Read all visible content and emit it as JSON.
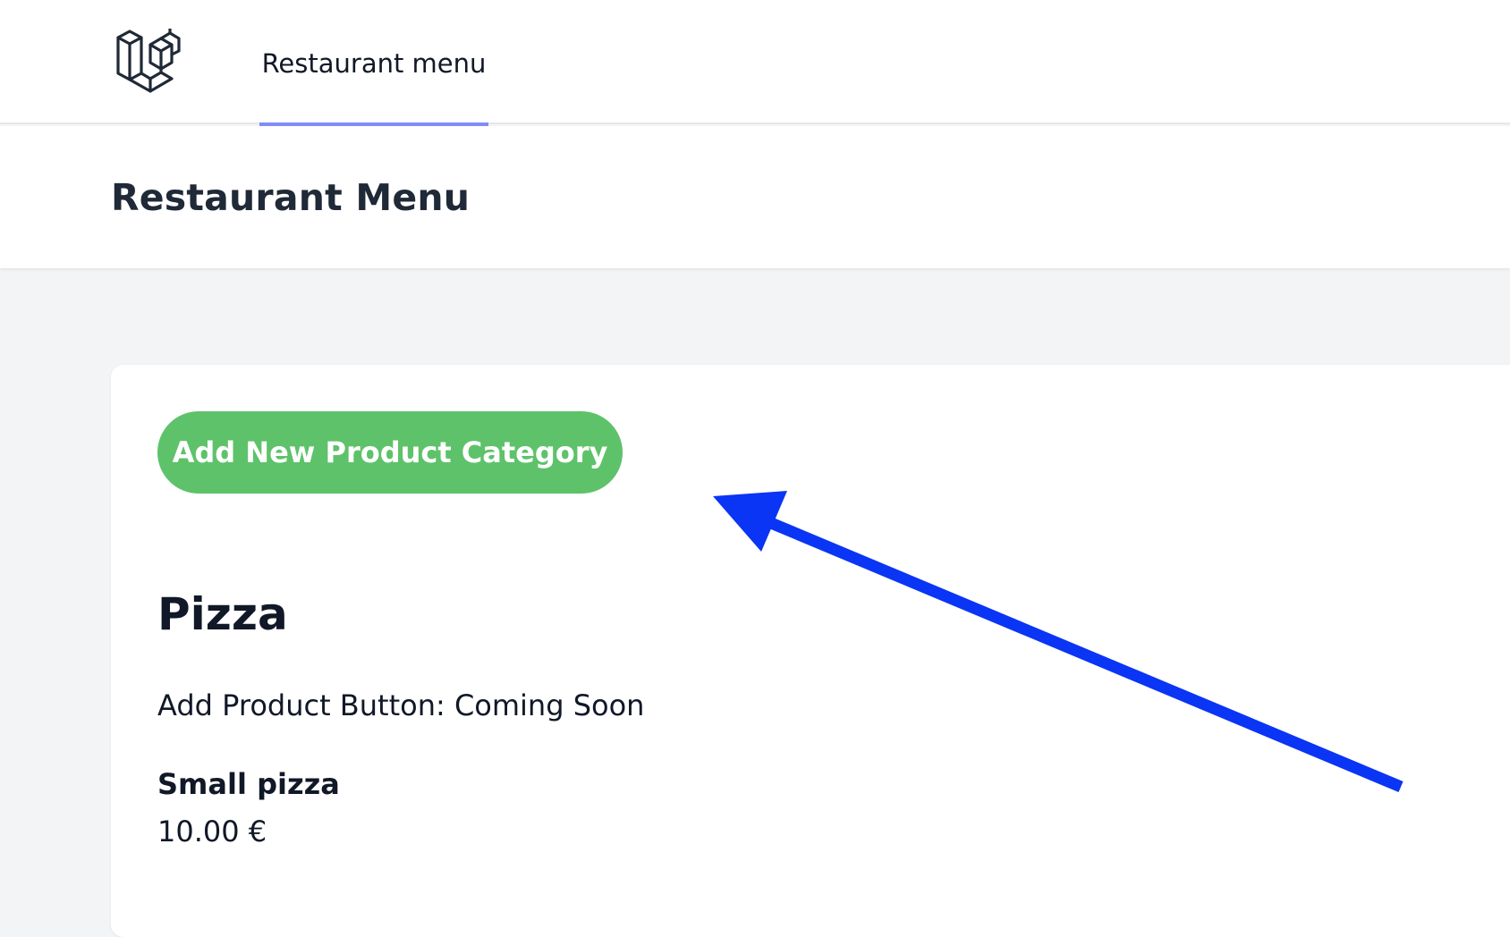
{
  "nav": {
    "logo_icon": "laravel-logo-icon",
    "links": [
      {
        "label": "Restaurant menu",
        "active": true
      }
    ],
    "active_color": "#818cf8"
  },
  "header": {
    "title": "Restaurant Menu"
  },
  "content": {
    "add_category_button": "Add New Product Category",
    "add_category_button_color": "#5ec26a",
    "categories": [
      {
        "name": "Pizza",
        "note": "Add Product Button: Coming Soon",
        "products": [
          {
            "name": "Small pizza",
            "price": "10.00 €"
          }
        ]
      }
    ]
  },
  "annotation": {
    "icon": "arrow-icon",
    "color": "#0a35f5"
  }
}
